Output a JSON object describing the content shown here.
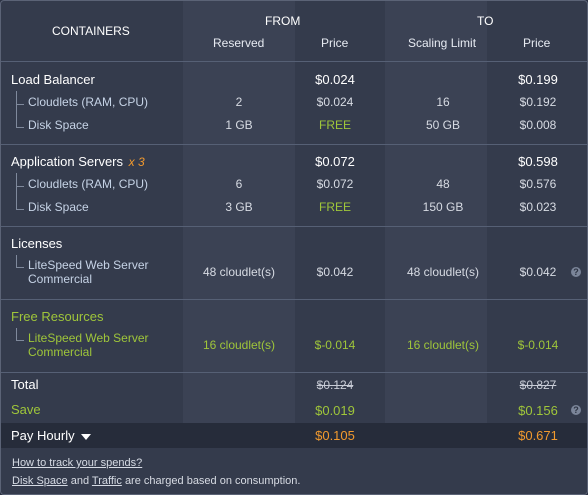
{
  "header": {
    "containers": "CONTAINERS",
    "from": "FROM",
    "to": "TO",
    "reserved": "Reserved",
    "price": "Price",
    "scaling_limit": "Scaling Limit",
    "price2": "Price"
  },
  "groups": [
    {
      "title": "Load Balancer",
      "multiplier": "",
      "from_total": "$0.024",
      "to_total": "$0.199",
      "rows": [
        {
          "label": "Cloudlets (RAM, CPU)",
          "reserved": "2",
          "price": "$0.024",
          "limit": "16",
          "price2": "$0.192"
        },
        {
          "label": "Disk Space",
          "reserved": "1 GB",
          "price": "FREE",
          "limit": "50 GB",
          "price2": "$0.008"
        }
      ]
    },
    {
      "title": "Application Servers",
      "multiplier": "x 3",
      "from_total": "$0.072",
      "to_total": "$0.598",
      "rows": [
        {
          "label": "Cloudlets (RAM, CPU)",
          "reserved": "6",
          "price": "$0.072",
          "limit": "48",
          "price2": "$0.576"
        },
        {
          "label": "Disk Space",
          "reserved": "3 GB",
          "price": "FREE",
          "limit": "150 GB",
          "price2": "$0.023"
        }
      ]
    },
    {
      "title": "Licenses",
      "rows": [
        {
          "label_line1": "LiteSpeed Web Server",
          "label_line2": "Commercial",
          "reserved": "48 cloudlet(s)",
          "price": "$0.042",
          "limit": "48 cloudlet(s)",
          "price2": "$0.042"
        }
      ]
    },
    {
      "title": "Free Resources",
      "rows": [
        {
          "label_line1": "LiteSpeed Web Server",
          "label_line2": "Commercial",
          "reserved": "16 cloudlet(s)",
          "price": "$-0.014",
          "limit": "16 cloudlet(s)",
          "price2": "$-0.014"
        }
      ]
    }
  ],
  "summary": {
    "total_label": "Total",
    "total_from": "$0.124",
    "total_to": "$0.827",
    "save_label": "Save",
    "save_from": "$0.019",
    "save_to": "$0.156",
    "pay_label": "Pay Hourly",
    "pay_from": "$0.105",
    "pay_to": "$0.671"
  },
  "footer": {
    "track_link": "How to track your spends?",
    "disk_link": "Disk Space",
    "and": "and",
    "traffic_link": "Traffic",
    "charged_text": "are charged based on consumption."
  },
  "colors": {
    "free_green": "#9fc63a",
    "pay_orange": "#f29a2e",
    "multiplier_orange": "#f0a030"
  },
  "icons": [
    "help-icon",
    "chevron-down-icon"
  ]
}
